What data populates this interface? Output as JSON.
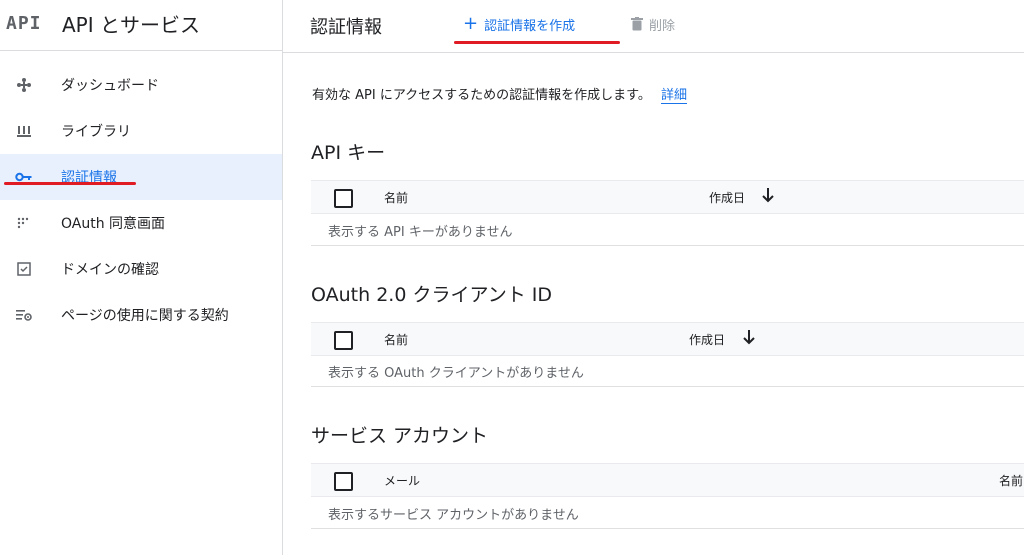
{
  "sidebar": {
    "logo": "API",
    "title": "API とサービス",
    "items": [
      {
        "label": "ダッシュボード",
        "icon": "dashboard-icon"
      },
      {
        "label": "ライブラリ",
        "icon": "library-icon"
      },
      {
        "label": "認証情報",
        "icon": "key-icon",
        "active": true
      },
      {
        "label": "OAuth 同意画面",
        "icon": "consent-icon"
      },
      {
        "label": "ドメインの確認",
        "icon": "checkbox-icon"
      },
      {
        "label": "ページの使用に関する契約",
        "icon": "settings-list-icon"
      }
    ]
  },
  "header": {
    "title": "認証情報",
    "create_label": "認証情報を作成",
    "delete_label": "削除"
  },
  "main": {
    "description": "有効な API にアクセスするための認証情報を作成します。",
    "details_link": "詳細",
    "sections": [
      {
        "title": "API キー",
        "col1": "名前",
        "col2": "作成日",
        "empty": "表示する API キーがありません"
      },
      {
        "title": "OAuth 2.0 クライアント ID",
        "col1": "名前",
        "col2": "作成日",
        "empty": "表示する OAuth クライアントがありません"
      },
      {
        "title": "サービス アカウント",
        "col1": "メール",
        "col2": "名前",
        "empty": "表示するサービス アカウントがありません"
      }
    ]
  },
  "colors": {
    "accent": "#1a73e8",
    "highlight": "#e01b24",
    "active_bg": "#e8f0fe"
  }
}
